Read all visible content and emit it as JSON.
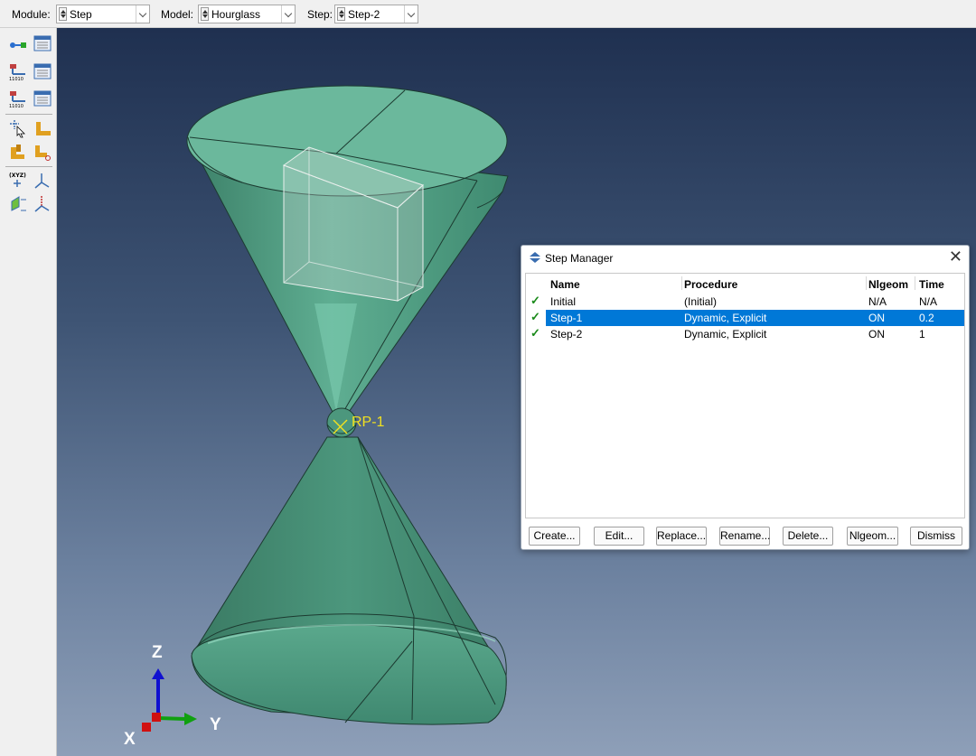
{
  "context_bar": {
    "module": {
      "label": "Module:",
      "value": "Step"
    },
    "model": {
      "label": "Model:",
      "value": "Hourglass"
    },
    "step": {
      "label": "Step:",
      "value": "Step-2"
    }
  },
  "viewport": {
    "rp_label": "RP-1",
    "triad": {
      "z": "Z",
      "y": "Y",
      "x": "X"
    },
    "part_color": "#4e9a80"
  },
  "step_manager": {
    "title": "Step Manager",
    "close_glyph": "✕",
    "columns": [
      "Name",
      "Procedure",
      "Nlgeom",
      "Time"
    ],
    "rows": [
      {
        "name": "Initial",
        "procedure": "(Initial)",
        "nlgeom": "N/A",
        "time": "N/A",
        "selected": false
      },
      {
        "name": "Step-1",
        "procedure": "Dynamic, Explicit",
        "nlgeom": "ON",
        "time": "0.2",
        "selected": true
      },
      {
        "name": "Step-2",
        "procedure": "Dynamic, Explicit",
        "nlgeom": "ON",
        "time": "1",
        "selected": false
      }
    ],
    "buttons": {
      "create": "Create...",
      "edit": "Edit...",
      "replace": "Replace...",
      "rename": "Rename...",
      "delete": "Delete...",
      "nlgeom": "Nlgeom...",
      "dismiss": "Dismiss"
    },
    "selection_color": "#0078d7",
    "check_color": "#1a8a1a"
  }
}
